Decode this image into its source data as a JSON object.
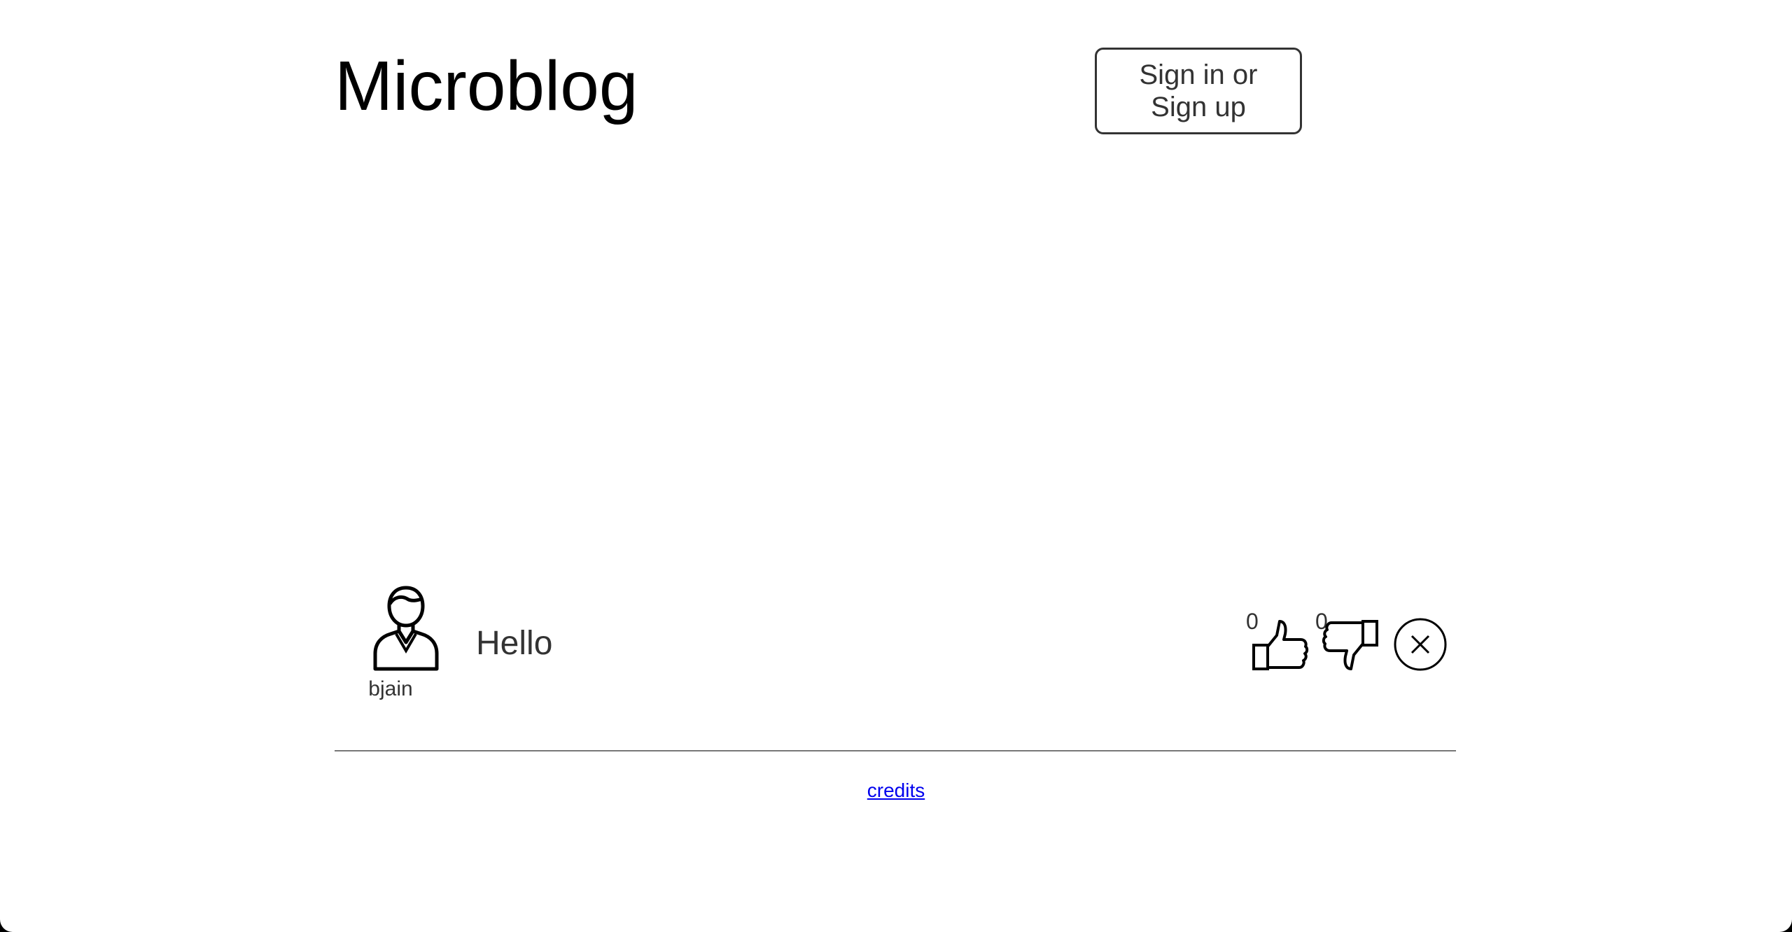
{
  "header": {
    "title": "Microblog",
    "signin_label": "Sign in or Sign up"
  },
  "posts": [
    {
      "username": "bjain",
      "text": "Hello",
      "likes": "0",
      "dislikes": "0",
      "avatar_icon": "user-avatar-icon",
      "like_icon": "thumbs-up-icon",
      "dislike_icon": "thumbs-down-icon",
      "delete_icon": "close-circle-icon"
    }
  ],
  "footer": {
    "credits_label": "credits"
  },
  "colors": {
    "text": "#333333",
    "link": "#0000ee",
    "divider": "#777777"
  }
}
